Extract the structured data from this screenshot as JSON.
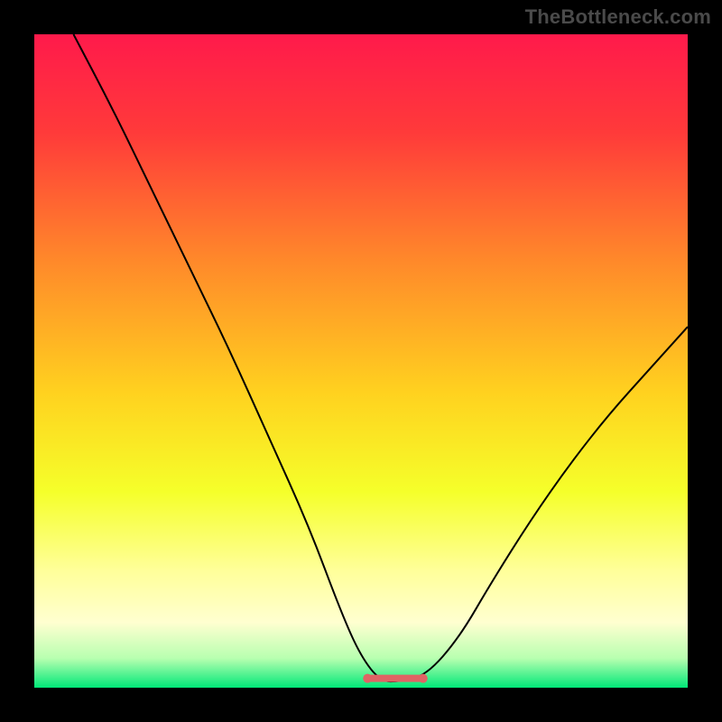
{
  "watermark": {
    "text": "TheBottleneck.com"
  },
  "chart_data": {
    "type": "line",
    "title": "",
    "xlabel": "",
    "ylabel": "",
    "xlim": [
      0,
      100
    ],
    "ylim": [
      0,
      105
    ],
    "grid": false,
    "background_gradient": {
      "stops": [
        {
          "offset": 0.0,
          "color": "#ff1a4b"
        },
        {
          "offset": 0.15,
          "color": "#ff3a3a"
        },
        {
          "offset": 0.35,
          "color": "#ff8a2a"
        },
        {
          "offset": 0.55,
          "color": "#ffd21f"
        },
        {
          "offset": 0.7,
          "color": "#f5ff2a"
        },
        {
          "offset": 0.82,
          "color": "#ffff99"
        },
        {
          "offset": 0.9,
          "color": "#ffffd0"
        },
        {
          "offset": 0.955,
          "color": "#b8ffb0"
        },
        {
          "offset": 1.0,
          "color": "#00e878"
        }
      ]
    },
    "series": [
      {
        "name": "bottleneck-curve",
        "color": "#000000",
        "width": 2,
        "x": [
          6,
          12,
          18,
          24,
          30,
          36,
          42,
          47,
          50,
          53,
          56,
          60,
          65,
          70,
          76,
          82,
          88,
          94,
          100
        ],
        "y": [
          105,
          93,
          80,
          67,
          54,
          40,
          26,
          12,
          5,
          1,
          1,
          2,
          8,
          17,
          27,
          36,
          44,
          51,
          58
        ]
      }
    ],
    "baseline_marker": {
      "name": "optimal-band",
      "color": "#e06464",
      "x_range": [
        51,
        59.5
      ],
      "y": 1.5,
      "thickness": 8,
      "end_dot_radius": 5
    }
  }
}
